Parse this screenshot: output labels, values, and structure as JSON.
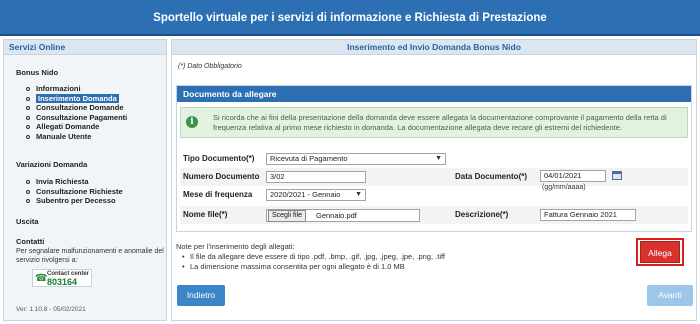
{
  "header": {
    "title": "Sportello virtuale per i servizi di informazione e Richiesta di Prestazione"
  },
  "sidebar": {
    "title": "Servizi Online",
    "sections": [
      {
        "label": "Bonus Nido",
        "items": [
          "Informazioni",
          "Inserimento Domanda",
          "Consultazione Domande",
          "Consultazione Pagamenti",
          "Allegati Domande",
          "Manuale Utente"
        ]
      },
      {
        "label": "Variazioni Domanda",
        "items": [
          "Invia Richiesta",
          "Consultazione Richieste",
          "Subentro per Decesso"
        ]
      },
      {
        "label": "Uscita",
        "items": []
      },
      {
        "label": "Contatti",
        "items": []
      }
    ],
    "active_item": "Inserimento Domanda",
    "contact_text": "Per segnalare malfunzionamenti e anomalie del servizio rivolgersi a:",
    "contact_center_label": "Contact center",
    "contact_center_number": "803164",
    "version": "Ver: 1.10.8 - 05/02/2021"
  },
  "main": {
    "title": "Inserimento ed Invio Domanda Bonus Nido",
    "required_note": "(*) Dato Obbligatorio",
    "doc_section_title": "Documento da allegare",
    "info_text": "Si ricorda che ai fini della presentazione della domanda deve essere allegata la documentazione comprovante il pagamento della retta di frequenza relativa al primo mese richiesto in domanda. La documentazione allegata deve recare gli estremi del richiedente.",
    "form": {
      "tipo_documento_label": "Tipo Documento(*)",
      "tipo_documento_value": "Ricevuta di Pagamento",
      "numero_documento_label": "Numero Documento",
      "numero_documento_value": "3/02",
      "data_documento_label": "Data Documento(*)",
      "data_documento_value": "04/01/2021",
      "data_hint": "(gg/mm/aaaa)",
      "mese_label": "Mese di frequenza",
      "mese_value": "2020/2021 - Gennaio",
      "nome_file_label": "Nome file(*)",
      "file_button_label": "Scegli file",
      "file_name": "Gennaio.pdf",
      "descrizione_label": "Descrizione(*)",
      "descrizione_value": "Fattura Gennaio 2021",
      "allega_label": "Allega"
    },
    "notes": {
      "title": "Note per l'inserimento degli allegati:",
      "items": [
        "Il file da allegare deve essere di tipo .pdf, .bmp, .gif, .jpg, .jpeg, .jpe, .png, .tiff",
        "La dimensione massima consentita per ogni allegato è di 1.0 MB"
      ]
    },
    "buttons": {
      "back": "Indietro",
      "next": "Avanti"
    }
  }
}
